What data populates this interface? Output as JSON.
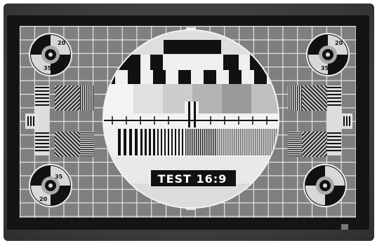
{
  "test_card": {
    "caption": "TEST 16:9",
    "corner_numbers": [
      "20",
      "35"
    ]
  },
  "colors": {
    "bezel": "#4a4a4a",
    "screen_frame": "#141414",
    "grid_background": "#7f7f7f",
    "grid_lines": "#eeeeee",
    "circle_fill": "#d9d9d9",
    "caption_background": "#111111",
    "caption_text": "#ffffff"
  }
}
